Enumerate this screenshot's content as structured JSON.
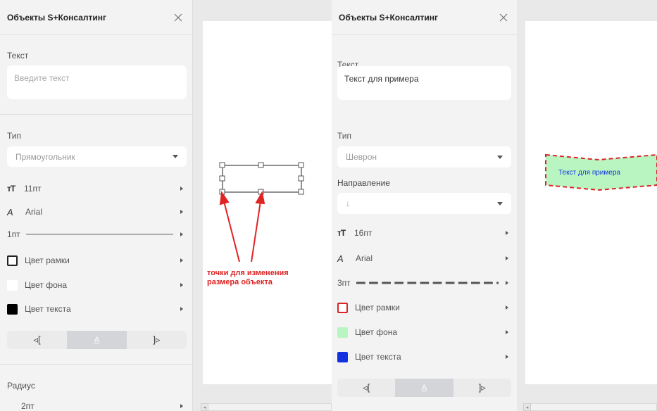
{
  "left_panel": {
    "title": "Объекты S+Консалтинг",
    "text_label": "Текст",
    "text_placeholder": "Введите текст",
    "type_label": "Тип",
    "type_value": "Прямоугольник",
    "font_size": "11пт",
    "font_name": "Arial",
    "stroke_width": "1пт",
    "border_color_label": "Цвет рамки",
    "fill_color_label": "Цвет фона",
    "text_color_label": "Цвет текста",
    "radius_label": "Радиус",
    "radius_value": "2пт",
    "colors": {
      "border": "#ffffff",
      "fill": "#ffffff",
      "text": "#000000"
    }
  },
  "right_panel": {
    "title": "Объекты S+Консалтинг",
    "text_label": "Текст",
    "text_value": "Текст для примера",
    "type_label": "Тип",
    "type_value": "Шеврон",
    "direction_label": "Направление",
    "direction_value": "↓",
    "font_size": "16пт",
    "font_name": "Arial",
    "stroke_width": "3пт",
    "border_color_label": "Цвет рамки",
    "fill_color_label": "Цвет фона",
    "text_color_label": "Цвет текста",
    "colors": {
      "border": "#d9262b",
      "fill": "#b9f5c1",
      "text": "#1232e0"
    }
  },
  "align": {
    "left": "◃[",
    "center": "A",
    "right": "]▹"
  },
  "icons": {
    "font_size": "tt-icon",
    "font": "a-pen-icon",
    "close": "close-icon",
    "chevron": "chevron-right-icon",
    "dropdown": "chevron-down-icon"
  },
  "annotation": {
    "line1": "точки для изменения",
    "line2": "размера объекта",
    "color": "#dd2222"
  },
  "chevron_shape": {
    "text": "Текст для примера"
  }
}
